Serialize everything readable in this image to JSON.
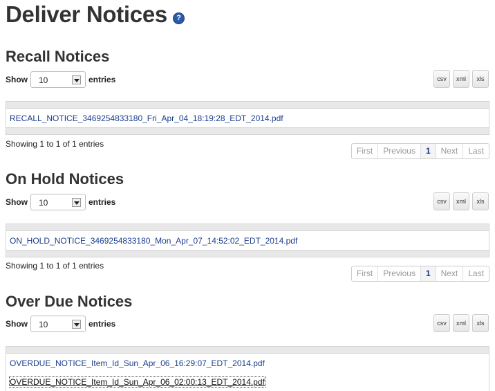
{
  "page": {
    "title": "Deliver Notices",
    "help_icon_glyph": "?"
  },
  "common": {
    "show_label": "Show",
    "entries_label": "entries",
    "export_buttons": [
      "csv",
      "xml",
      "xls"
    ],
    "pager": [
      "First",
      "Previous",
      "1",
      "Next",
      "Last"
    ]
  },
  "sections": [
    {
      "title": "Recall Notices",
      "page_size": "10",
      "rows": [
        "RECALL_NOTICE_3469254833180_Fri_Apr_04_18:19:28_EDT_2014.pdf"
      ],
      "info": "Showing 1 to 1 of 1 entries"
    },
    {
      "title": "On Hold Notices",
      "page_size": "10",
      "rows": [
        "ON_HOLD_NOTICE_3469254833180_Mon_Apr_07_14:52:02_EDT_2014.pdf"
      ],
      "info": "Showing 1 to 1 of 1 entries"
    },
    {
      "title": "Over Due Notices",
      "page_size": "10",
      "rows": [
        "OVERDUE_NOTICE_Item_Id_Sun_Apr_06_16:29:07_EDT_2014.pdf",
        "OVERDUE_NOTICE_Item_Id_Sun_Apr_06_02:00:13_EDT_2014.pdf"
      ]
    }
  ]
}
